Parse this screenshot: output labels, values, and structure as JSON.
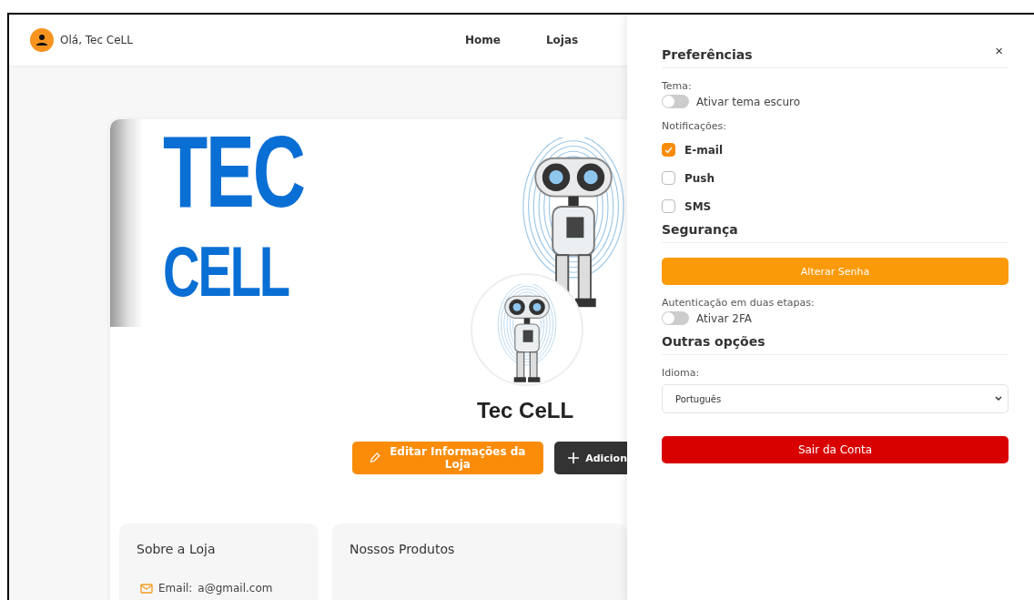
{
  "header": {
    "greeting": "Olá, Tec CeLL",
    "nav": [
      {
        "label": "Home"
      },
      {
        "label": "Lojas"
      }
    ]
  },
  "store": {
    "banner_logo": [
      "TEC",
      "CELL"
    ],
    "name": "Tec CeLL",
    "buttons": [
      {
        "kind": "primary",
        "label": "Editar Informações da Loja"
      },
      {
        "kind": "dark",
        "label": "Adicion"
      }
    ],
    "about": {
      "title": "Sobre a Loja",
      "email_label": "Email:",
      "email": "a@gmail.com"
    },
    "products": {
      "title": "Nossos Produtos"
    }
  },
  "panel": {
    "title": "Preferências",
    "close": "×",
    "theme": {
      "label": "Tema:",
      "toggle": {
        "label": "Ativar tema escuro",
        "on": false
      }
    },
    "notifications": {
      "label": "Notificações:",
      "options": [
        {
          "label": "E-mail",
          "checked": true
        },
        {
          "label": "Push",
          "checked": false
        },
        {
          "label": "SMS",
          "checked": false
        }
      ]
    },
    "security": {
      "title": "Segurança",
      "button": "Alterar Senha",
      "two_factor": {
        "label": "Autenticação em duas etapas:",
        "toggle": {
          "label": "Ativar 2FA",
          "on": false
        }
      }
    },
    "other": {
      "title": "Outras opções",
      "language": {
        "label": "Idioma:",
        "value": "Português"
      }
    },
    "logout": "Sair da Conta"
  }
}
